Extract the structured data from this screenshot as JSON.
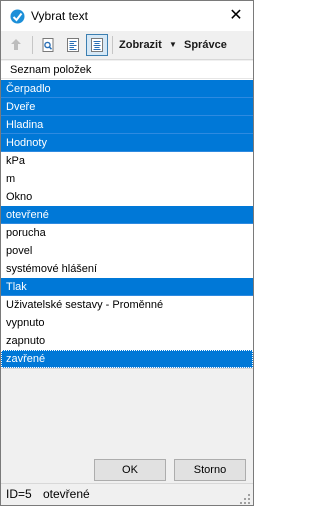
{
  "window": {
    "title": "Vybrat text",
    "close_glyph": "✕"
  },
  "toolbar": {
    "view_label": "Zobrazit",
    "view_arrow": "▼",
    "manager_label": "Správce",
    "icons": [
      "up-arrow-icon",
      "find-icon",
      "align-left-icon",
      "align-center-icon"
    ]
  },
  "list": {
    "header": "Seznam položek",
    "items": [
      {
        "label": "Čerpadlo",
        "selected": true
      },
      {
        "label": "Dveře",
        "selected": true
      },
      {
        "label": "Hladina",
        "selected": true
      },
      {
        "label": "Hodnoty",
        "selected": true
      },
      {
        "label": "kPa",
        "selected": false
      },
      {
        "label": "m",
        "selected": false
      },
      {
        "label": "Okno",
        "selected": false
      },
      {
        "label": "otevřené",
        "selected": true
      },
      {
        "label": "porucha",
        "selected": false
      },
      {
        "label": "povel",
        "selected": false
      },
      {
        "label": "systémové hlášení",
        "selected": false
      },
      {
        "label": "Tlak",
        "selected": true
      },
      {
        "label": "Uživatelské sestavy - Proměnné",
        "selected": false
      },
      {
        "label": "vypnuto",
        "selected": false
      },
      {
        "label": "zapnuto",
        "selected": false
      },
      {
        "label": "zavřené",
        "selected": true
      }
    ]
  },
  "buttons": {
    "ok": "OK",
    "cancel": "Storno"
  },
  "status": {
    "id_text": "ID=5",
    "value_text": "otevřené"
  },
  "colors": {
    "selection": "#0078d7",
    "accent": "#3c7fb1"
  }
}
